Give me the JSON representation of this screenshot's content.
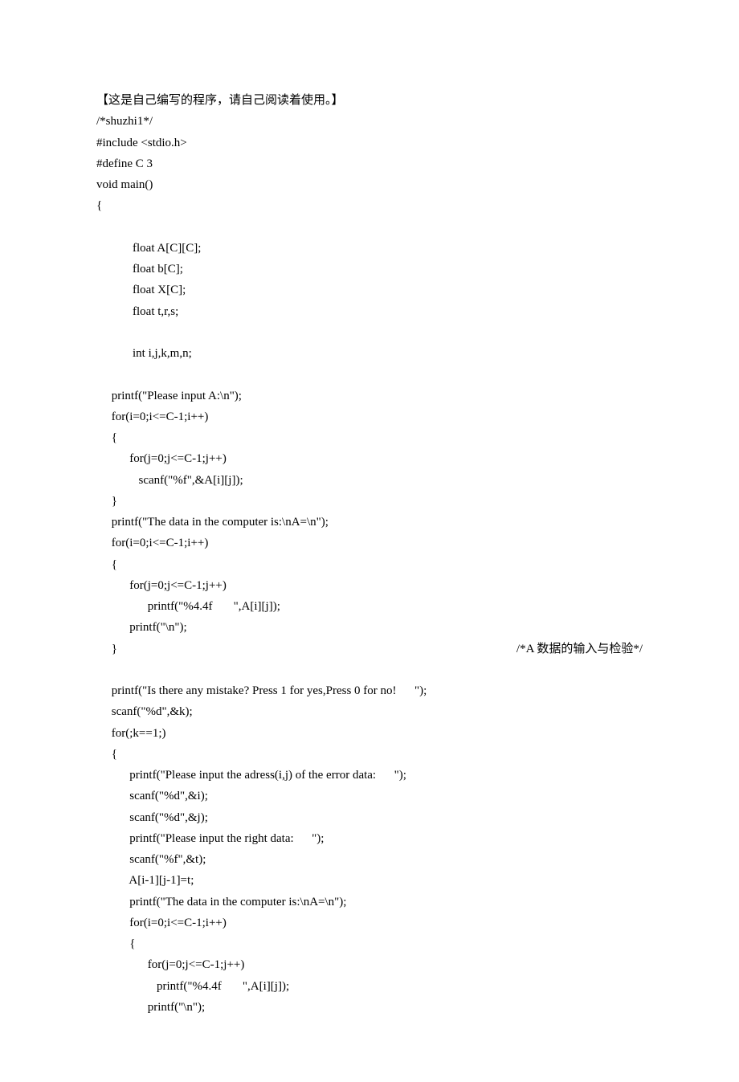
{
  "lines": [
    "【这是自己编写的程序，请自己阅读着使用。】",
    "/*shuzhi1*/",
    "#include <stdio.h>",
    "#define C 3",
    "void main()",
    "{",
    "",
    "            float A[C][C];",
    "            float b[C];",
    "            float X[C];",
    "            float t,r,s;",
    "",
    "            int i,j,k,m,n;",
    "",
    "     printf(\"Please input A:\\n\");",
    "     for(i=0;i<=C-1;i++)",
    "     {",
    "           for(j=0;j<=C-1;j++)",
    "              scanf(\"%f\",&A[i][j]);",
    "     }",
    "     printf(\"The data in the computer is:\\nA=\\n\");",
    "     for(i=0;i<=C-1;i++)",
    "     {",
    "           for(j=0;j<=C-1;j++)",
    "                 printf(\"%4.4f       \",A[i][j]);",
    "           printf(\"\\n\");"
  ],
  "split_line": {
    "left": "     }",
    "right": "/*A 数据的输入与检验*/"
  },
  "lines2": [
    "",
    "     printf(\"Is there any mistake? Press 1 for yes,Press 0 for no!      \");",
    "     scanf(\"%d\",&k);",
    "     for(;k==1;)",
    "     {",
    "           printf(\"Please input the adress(i,j) of the error data:      \");",
    "           scanf(\"%d\",&i);",
    "           scanf(\"%d\",&j);",
    "           printf(\"Please input the right data:      \");",
    "           scanf(\"%f\",&t);",
    "           A[i-1][j-1]=t;",
    "           printf(\"The data in the computer is:\\nA=\\n\");",
    "           for(i=0;i<=C-1;i++)",
    "           {",
    "                 for(j=0;j<=C-1;j++)",
    "                    printf(\"%4.4f       \",A[i][j]);",
    "                 printf(\"\\n\");"
  ]
}
